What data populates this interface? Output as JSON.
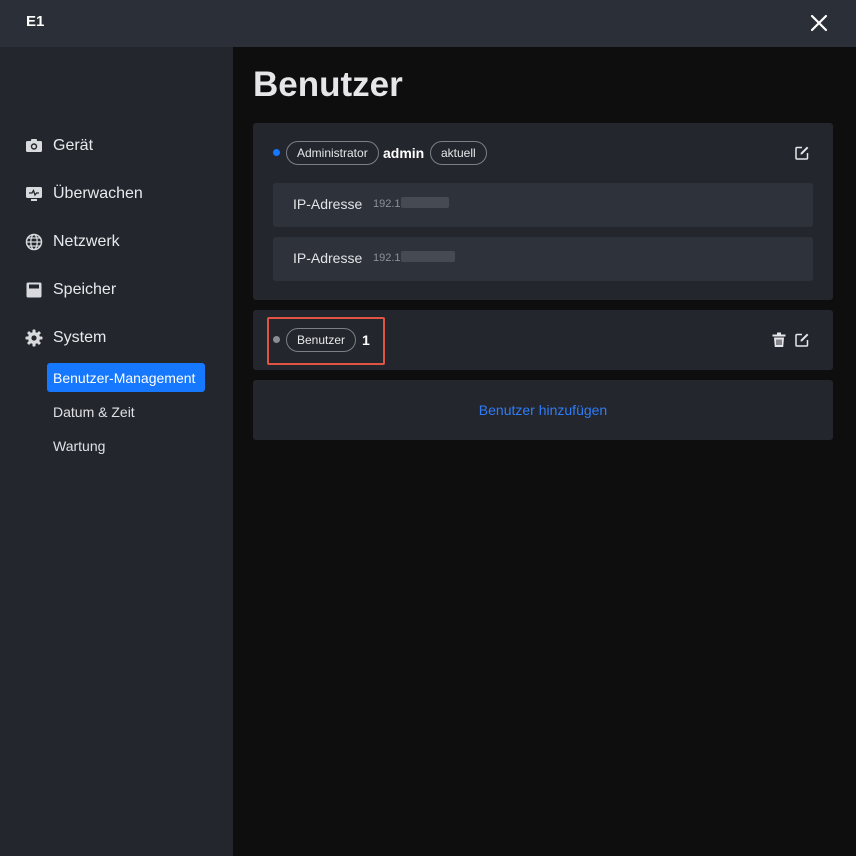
{
  "window": {
    "title": "E1"
  },
  "sidebar": {
    "items": [
      {
        "label": "Gerät",
        "icon": "camera-icon"
      },
      {
        "label": "Überwachen",
        "icon": "monitor-icon"
      },
      {
        "label": "Netzwerk",
        "icon": "globe-icon"
      },
      {
        "label": "Speicher",
        "icon": "storage-icon"
      },
      {
        "label": "System",
        "icon": "gear-icon"
      }
    ],
    "subitems": [
      {
        "label": "Benutzer-Management",
        "active": true
      },
      {
        "label": "Datum & Zeit",
        "active": false
      },
      {
        "label": "Wartung",
        "active": false
      }
    ]
  },
  "main": {
    "title": "Benutzer",
    "admin_card": {
      "role": "Administrator",
      "name": "admin",
      "current_badge": "aktuell",
      "status_color": "#1677ff",
      "ip_rows": [
        {
          "label": "IP-Adresse",
          "value": "192.1"
        },
        {
          "label": "IP-Adresse",
          "value": "192.1"
        }
      ]
    },
    "user_card": {
      "role": "Benutzer",
      "name": "1",
      "status_color": "#8a8d93"
    },
    "add_user_label": "Benutzer hinzufügen"
  },
  "colors": {
    "accent": "#1677ff",
    "link": "#2f7cf6",
    "highlight": "#e05444"
  }
}
